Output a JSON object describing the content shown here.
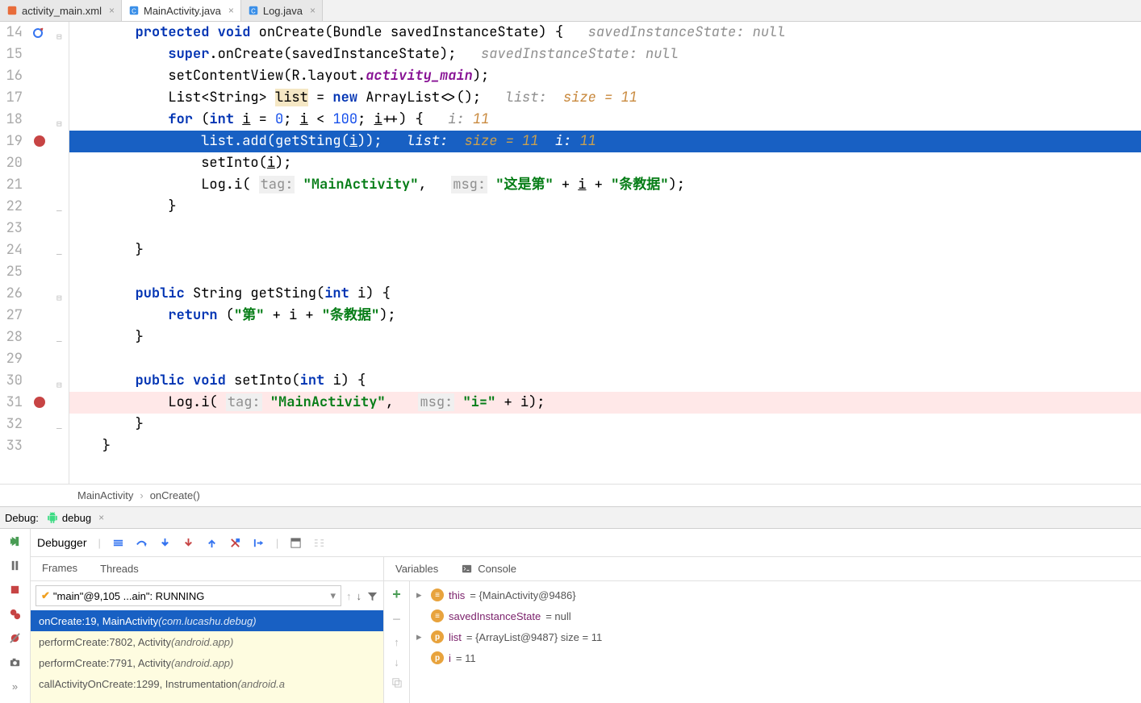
{
  "tabs": [
    {
      "label": "activity_main.xml",
      "active": false,
      "kind": "xml"
    },
    {
      "label": "MainActivity.java",
      "active": true,
      "kind": "java"
    },
    {
      "label": "Log.java",
      "active": false,
      "kind": "java"
    }
  ],
  "editor": {
    "first_line": 14,
    "highlighted_line": 19,
    "breakpoint_lines": [
      19,
      31
    ],
    "lines": [
      {
        "n": 14,
        "indent": 2,
        "tokens": [
          [
            "kw",
            "protected"
          ],
          [
            "sp",
            " "
          ],
          [
            "kw",
            "void"
          ],
          [
            "sp",
            " "
          ],
          [
            "plain",
            "onCreate(Bundle savedInstanceState) {   "
          ],
          [
            "hint",
            "savedInstanceState: null"
          ]
        ],
        "mark": "override"
      },
      {
        "n": 15,
        "indent": 3,
        "tokens": [
          [
            "kw",
            "super"
          ],
          [
            "plain",
            ".onCreate(savedInstanceState);   "
          ],
          [
            "hint",
            "savedInstanceState: null"
          ]
        ]
      },
      {
        "n": 16,
        "indent": 3,
        "tokens": [
          [
            "plain",
            "setContentView(R.layout."
          ],
          [
            "ident",
            "activity_main"
          ],
          [
            "plain",
            ");"
          ]
        ]
      },
      {
        "n": 17,
        "indent": 3,
        "tokens": [
          [
            "plain",
            "List<String> "
          ],
          [
            "listhl",
            "list"
          ],
          [
            "plain",
            " = "
          ],
          [
            "kw",
            "new"
          ],
          [
            "plain",
            " ArrayList<>();   "
          ],
          [
            "hint",
            "list:  "
          ],
          [
            "hint2",
            "size = 11"
          ]
        ]
      },
      {
        "n": 18,
        "indent": 3,
        "tokens": [
          [
            "kw",
            "for"
          ],
          [
            "plain",
            " ("
          ],
          [
            "kw",
            "int"
          ],
          [
            "sp",
            " "
          ],
          [
            "under",
            "i"
          ],
          [
            "plain",
            " = "
          ],
          [
            "num",
            "0"
          ],
          [
            "plain",
            "; "
          ],
          [
            "under",
            "i"
          ],
          [
            "plain",
            " < "
          ],
          [
            "num",
            "100"
          ],
          [
            "plain",
            "; "
          ],
          [
            "under",
            "i"
          ],
          [
            "plain",
            "++) {   "
          ],
          [
            "hint",
            "i: "
          ],
          [
            "hint2",
            "11"
          ]
        ]
      },
      {
        "n": 19,
        "indent": 4,
        "tokens": [
          [
            "plain",
            "list.add(getSting("
          ],
          [
            "under",
            "i"
          ],
          [
            "plain",
            "));   "
          ],
          [
            "hint",
            "list:  "
          ],
          [
            "hint2",
            "size = 11"
          ],
          [
            "hint",
            "  i: "
          ],
          [
            "hint2",
            "11"
          ]
        ],
        "hl": true
      },
      {
        "n": 20,
        "indent": 4,
        "tokens": [
          [
            "plain",
            "setInto("
          ],
          [
            "under",
            "i"
          ],
          [
            "plain",
            ");"
          ]
        ]
      },
      {
        "n": 21,
        "indent": 4,
        "tokens": [
          [
            "plain",
            "Log.i( "
          ],
          [
            "param",
            "tag:"
          ],
          [
            "sp",
            " "
          ],
          [
            "str",
            "\"MainActivity\""
          ],
          [
            "plain",
            ",   "
          ],
          [
            "param",
            "msg:"
          ],
          [
            "sp",
            " "
          ],
          [
            "str",
            "\"这是第\""
          ],
          [
            "plain",
            " + "
          ],
          [
            "under",
            "i"
          ],
          [
            "plain",
            " + "
          ],
          [
            "str",
            "\"条教据\""
          ],
          [
            "plain",
            ");"
          ]
        ]
      },
      {
        "n": 22,
        "indent": 3,
        "tokens": [
          [
            "plain",
            "}"
          ]
        ]
      },
      {
        "n": 23,
        "indent": 0,
        "tokens": []
      },
      {
        "n": 24,
        "indent": 2,
        "tokens": [
          [
            "plain",
            "}"
          ]
        ]
      },
      {
        "n": 25,
        "indent": 0,
        "tokens": []
      },
      {
        "n": 26,
        "indent": 2,
        "tokens": [
          [
            "kw",
            "public"
          ],
          [
            "sp",
            " "
          ],
          [
            "plain",
            "String getSting("
          ],
          [
            "kw",
            "int"
          ],
          [
            "plain",
            " i) {"
          ]
        ]
      },
      {
        "n": 27,
        "indent": 3,
        "tokens": [
          [
            "kw",
            "return"
          ],
          [
            "plain",
            " ("
          ],
          [
            "str",
            "\"第\""
          ],
          [
            "plain",
            " + i + "
          ],
          [
            "str",
            "\"条教据\""
          ],
          [
            "plain",
            ");"
          ]
        ]
      },
      {
        "n": 28,
        "indent": 2,
        "tokens": [
          [
            "plain",
            "}"
          ]
        ]
      },
      {
        "n": 29,
        "indent": 0,
        "tokens": []
      },
      {
        "n": 30,
        "indent": 2,
        "tokens": [
          [
            "kw",
            "public"
          ],
          [
            "sp",
            " "
          ],
          [
            "kw",
            "void"
          ],
          [
            "plain",
            " setInto("
          ],
          [
            "kw",
            "int"
          ],
          [
            "plain",
            " i) {"
          ]
        ]
      },
      {
        "n": 31,
        "indent": 3,
        "tokens": [
          [
            "plain",
            "Log.i( "
          ],
          [
            "param",
            "tag:"
          ],
          [
            "sp",
            " "
          ],
          [
            "str",
            "\"MainActivity\""
          ],
          [
            "plain",
            ",   "
          ],
          [
            "param",
            "msg:"
          ],
          [
            "sp",
            " "
          ],
          [
            "str",
            "\"i=\""
          ],
          [
            "plain",
            " + i);"
          ]
        ],
        "bp_bg": true
      },
      {
        "n": 32,
        "indent": 2,
        "tokens": [
          [
            "plain",
            "}"
          ]
        ]
      },
      {
        "n": 33,
        "indent": 1,
        "tokens": [
          [
            "plain",
            "}"
          ]
        ]
      }
    ]
  },
  "breadcrumb": {
    "class": "MainActivity",
    "method": "onCreate()"
  },
  "debug": {
    "title": "Debug:",
    "config": "debug",
    "toolbar": {
      "debugger": "Debugger"
    },
    "tabs": {
      "frames": "Frames",
      "threads": "Threads",
      "variables": "Variables",
      "console": "Console"
    },
    "thread": "\"main\"@9,105 ...ain\": RUNNING",
    "frames": [
      {
        "label": "onCreate:19, MainActivity ",
        "pkg": "(com.lucashu.debug)",
        "sel": true
      },
      {
        "label": "performCreate:7802, Activity ",
        "pkg": "(android.app)",
        "sel": false
      },
      {
        "label": "performCreate:7791, Activity ",
        "pkg": "(android.app)",
        "sel": false
      },
      {
        "label": "callActivityOnCreate:1299, Instrumentation ",
        "pkg": "(android.a",
        "sel": false
      }
    ],
    "variables": [
      {
        "arrow": "▸",
        "icon": "eq",
        "name": "this",
        "val": " = {MainActivity@9486}"
      },
      {
        "arrow": "",
        "icon": "eq",
        "name": "savedInstanceState",
        "val": " = null"
      },
      {
        "arrow": "▸",
        "icon": "p",
        "name": "list",
        "val": " = {ArrayList@9487}  size = 11"
      },
      {
        "arrow": "",
        "icon": "p",
        "name": "i",
        "val": " = 11"
      }
    ]
  }
}
